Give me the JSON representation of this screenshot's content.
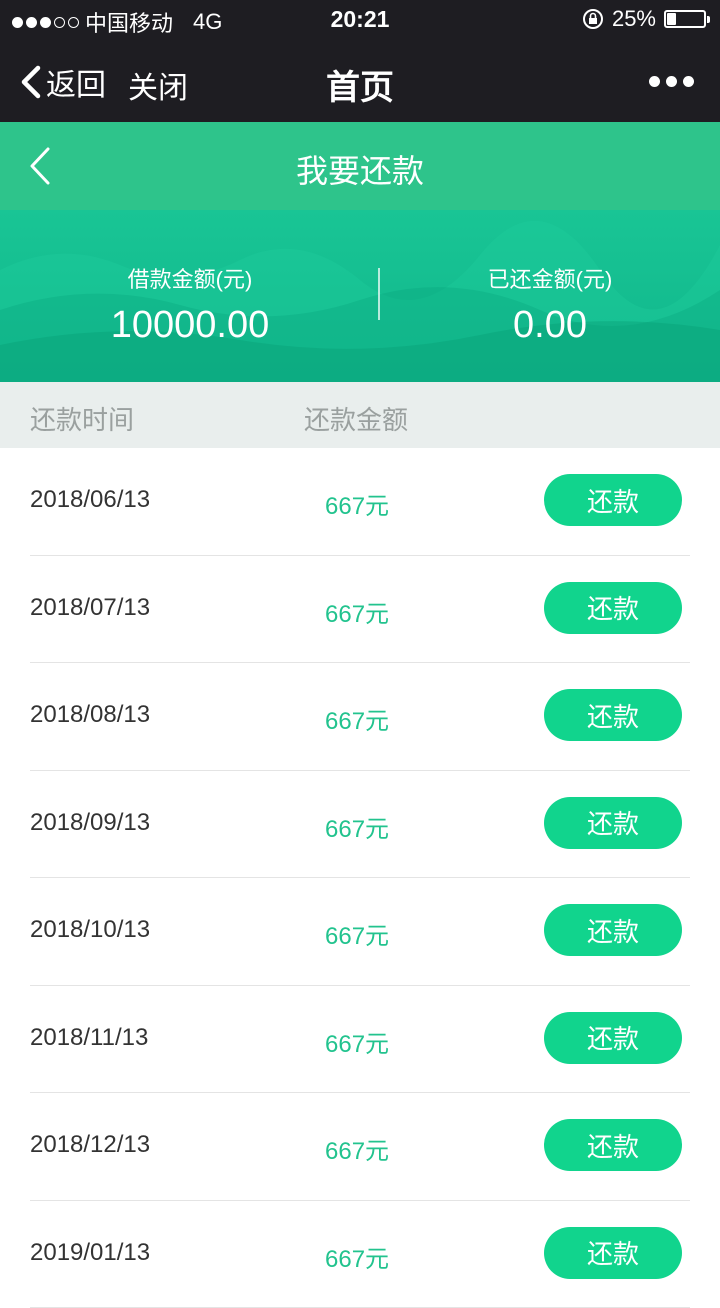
{
  "status_bar": {
    "carrier": "中国移动",
    "network": "4G",
    "time": "20:21",
    "battery": "25%",
    "battery_level": 0.25,
    "signal_bars": 3,
    "signal_total": 5,
    "icons": [
      "orientation-lock-icon",
      "battery-icon"
    ]
  },
  "nav": {
    "back_label": "返回",
    "close_label": "关闭",
    "title": "首页",
    "more_icon": "more-dots-icon"
  },
  "header": {
    "title": "我要还款",
    "back_icon": "chevron-left-icon"
  },
  "summary": {
    "loan_label": "借款金额(元)",
    "loan_value": "10000.00",
    "repaid_label": "已还金额(元)",
    "repaid_value": "0.00"
  },
  "table": {
    "col_date": "还款时间",
    "col_amount": "还款金额",
    "rows": [
      {
        "date": "2018/06/13",
        "amount": "667元",
        "button": "还款"
      },
      {
        "date": "2018/07/13",
        "amount": "667元",
        "button": "还款"
      },
      {
        "date": "2018/08/13",
        "amount": "667元",
        "button": "还款"
      },
      {
        "date": "2018/09/13",
        "amount": "667元",
        "button": "还款"
      },
      {
        "date": "2018/10/13",
        "amount": "667元",
        "button": "还款"
      },
      {
        "date": "2018/11/13",
        "amount": "667元",
        "button": "还款"
      },
      {
        "date": "2018/12/13",
        "amount": "667元",
        "button": "还款"
      },
      {
        "date": "2019/01/13",
        "amount": "667元",
        "button": "还款"
      }
    ]
  },
  "colors": {
    "dark_bar": "#1e1d22",
    "header_green": "#2ec48b",
    "button_green": "#11d48d",
    "amount_green": "#22c38e"
  }
}
